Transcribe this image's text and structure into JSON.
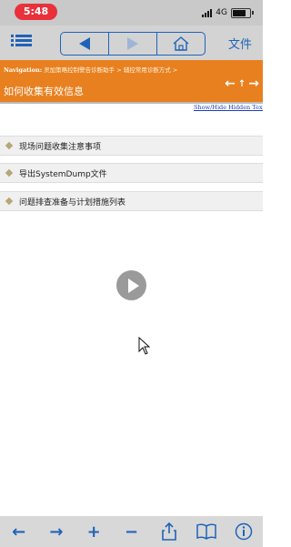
{
  "status": {
    "time": "5:48",
    "network": "4G"
  },
  "toolbar": {
    "doc_label": "文件"
  },
  "navigation": {
    "label": "Navigation:",
    "path": "灵加策略控制警告诊断助手 > 辅控常用诊断方式 >",
    "title": "如何收集有效信息"
  },
  "content": {
    "show_hide": "Show/Hide Hidden Text",
    "topics": [
      {
        "label": "现场问题收集注意事项"
      },
      {
        "label": "导出SystemDump文件"
      },
      {
        "label": "问题排查准备与计划措施列表"
      }
    ]
  },
  "icons": {
    "menu": "list-menu-icon",
    "back": "back-arrow-icon",
    "forward": "forward-arrow-icon",
    "home": "home-icon",
    "play": "play-icon",
    "cursor": "mouse-cursor-icon"
  },
  "colors": {
    "accent": "#1f63b8",
    "nav_bar": "#e8801f",
    "time_pill": "#e8313b"
  }
}
